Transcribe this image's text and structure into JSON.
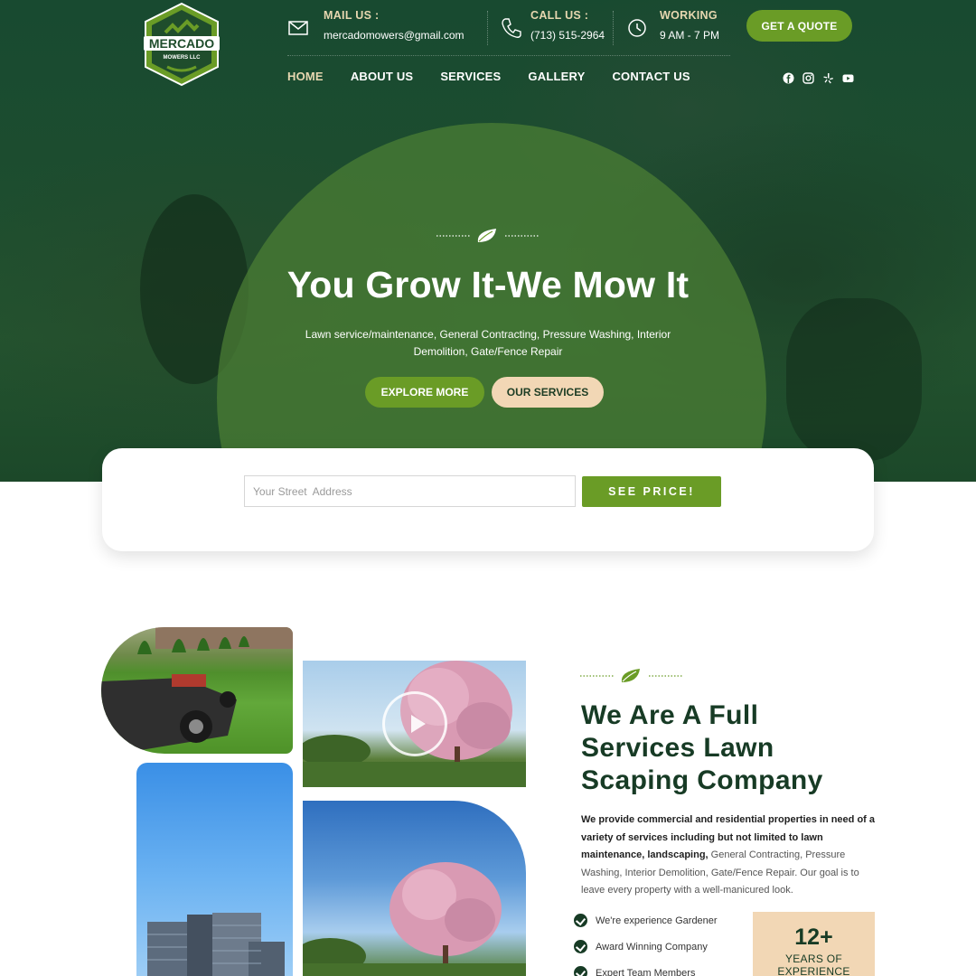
{
  "brand": {
    "logo_name": "MERCADO",
    "logo_sub": "MOWERS LLC",
    "accent": "#6a9c26",
    "dark_green": "#173b25",
    "beige": "#f2d7b5"
  },
  "contact": {
    "mail_title": "MAIL US :",
    "mail_value": "mercadomowers@gmail.com",
    "call_title": "CALL US :",
    "call_value": "(713) 515-2964",
    "work_title": "WORKING",
    "work_value": "9 AM - 7 PM"
  },
  "header": {
    "quote_button": "GET A QUOTE"
  },
  "nav": [
    {
      "label": "HOME"
    },
    {
      "label": "ABOUT US"
    },
    {
      "label": "SERVICES"
    },
    {
      "label": "GALLERY"
    },
    {
      "label": "CONTACT US"
    }
  ],
  "social_icons": [
    "facebook-icon",
    "instagram-icon",
    "yelp-icon",
    "youtube-icon"
  ],
  "hero": {
    "title": "You Grow It-We Mow It",
    "subtitle": "Lawn service/maintenance, General Contracting, Pressure Washing, Interior Demolition, Gate/Fence Repair",
    "explore_button": "EXPLORE MORE",
    "services_button": "OUR SERVICES"
  },
  "price": {
    "address_placeholder": "Your Street  Address",
    "address_value": "",
    "button": "SEE PRICE!"
  },
  "about": {
    "title": "We Are A Full Services Lawn Scaping Company",
    "text_bold": "We provide commercial and residential properties in need of a variety of services including but not limited to lawn maintenance, landscaping,",
    "text_rest": " General Contracting, Pressure Washing, Interior Demolition, Gate/Fence Repair. Our goal is to leave every property with a well-manicured look.",
    "checks": [
      "We're experience Gardener",
      "Award Winning Company",
      "Expert Team Members"
    ],
    "experience_number": "12+",
    "experience_label": "YEARS OF EXPERIENCE"
  }
}
